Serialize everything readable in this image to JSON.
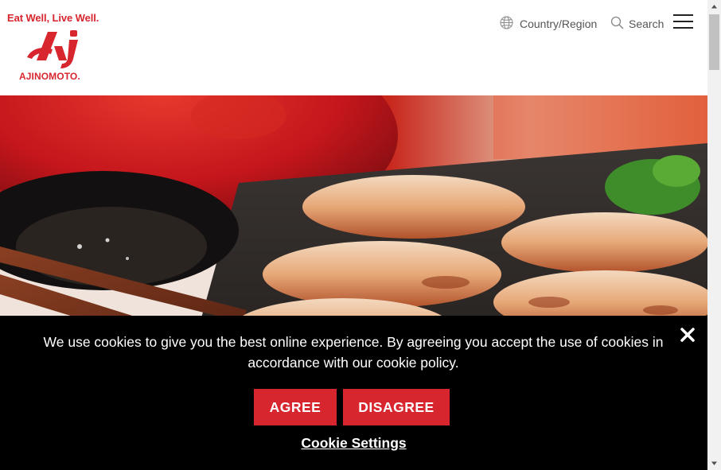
{
  "header": {
    "tagline": "Eat Well, Live Well.",
    "brand": "AJINOMOTO.",
    "logo_mark": "Aj",
    "nav": {
      "country_label": "Country/Region",
      "search_label": "Search"
    }
  },
  "hero": {
    "alt": "Pan-fried gyoza dumplings with soy dipping sauce"
  },
  "cookie_banner": {
    "message": "We use cookies to give you the best online experience. By agreeing you accept the use of cookies in accordance with our cookie policy.",
    "agree_label": "AGREE",
    "disagree_label": "DISAGREE",
    "settings_label": "Cookie Settings"
  },
  "icons": {
    "globe": "globe-icon",
    "search": "search-icon",
    "menu": "hamburger-menu-icon",
    "close": "close-icon"
  },
  "colors": {
    "brand_red": "#d7262e",
    "banner_bg": "#000000",
    "nav_text": "#555555"
  }
}
